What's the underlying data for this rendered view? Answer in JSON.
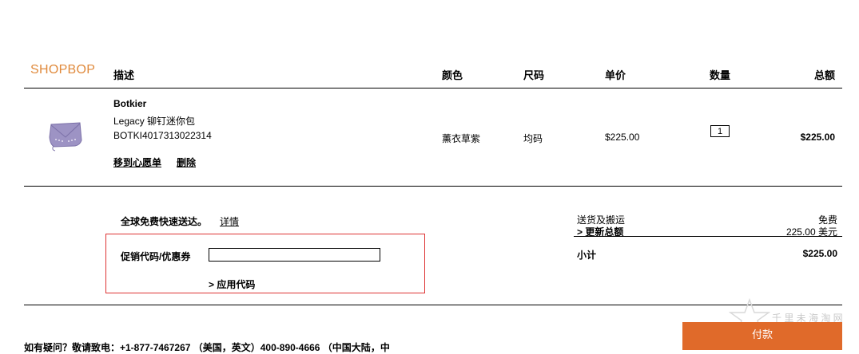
{
  "logo": "SHOPBOP",
  "headers": {
    "description": "描述",
    "color": "颜色",
    "size": "尺码",
    "unit_price": "单价",
    "quantity": "数量",
    "total": "总额"
  },
  "item": {
    "brand": "Botkier",
    "name": "Legacy 铆钉迷你包",
    "sku": "BOTKI4017313022314",
    "color": "薰衣草紫",
    "size": "均码",
    "unit_price": "$225.00",
    "quantity": "1",
    "total": "$225.00",
    "move_to_wishlist": "移到心愿单",
    "delete": "删除"
  },
  "shipping_promo": {
    "text": "全球免费快速送达。",
    "details": "详情"
  },
  "promo": {
    "label": "促销代码/优惠券",
    "value": "",
    "apply": "> 应用代码"
  },
  "summary": {
    "shipping_label": "送货及搬运",
    "shipping_value": "免费",
    "update_total": "> 更新总额",
    "converted": "225.00 美元",
    "subtotal_label": "小计",
    "subtotal_value": "$225.00"
  },
  "help_text": "如有疑问？敬请致电：+1-877-7467267 （美国，英文）400-890-4666 （中国大陆，中",
  "pay_button": "付款",
  "watermark": "千 里 未 海 淘 网",
  "colors": {
    "logo": "#e08a3c",
    "pay_button": "#e06a2a",
    "promo_border": "#dd3333"
  }
}
